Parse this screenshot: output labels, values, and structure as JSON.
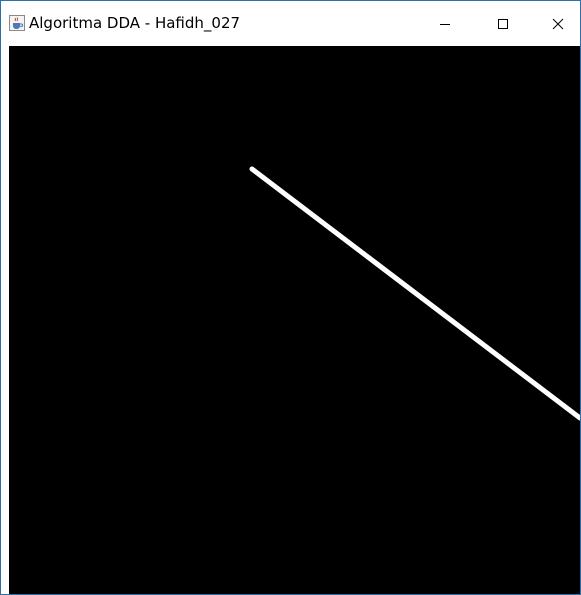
{
  "window": {
    "title": "Algoritma DDA - Hafidh_027",
    "icon": "java-cup-icon",
    "controls": {
      "minimize_icon": "minimize-icon",
      "maximize_icon": "maximize-icon",
      "close_icon": "close-icon"
    }
  },
  "canvas": {
    "background_color": "#000000",
    "line_color": "#ffffff",
    "line_icon": "line-segment"
  }
}
